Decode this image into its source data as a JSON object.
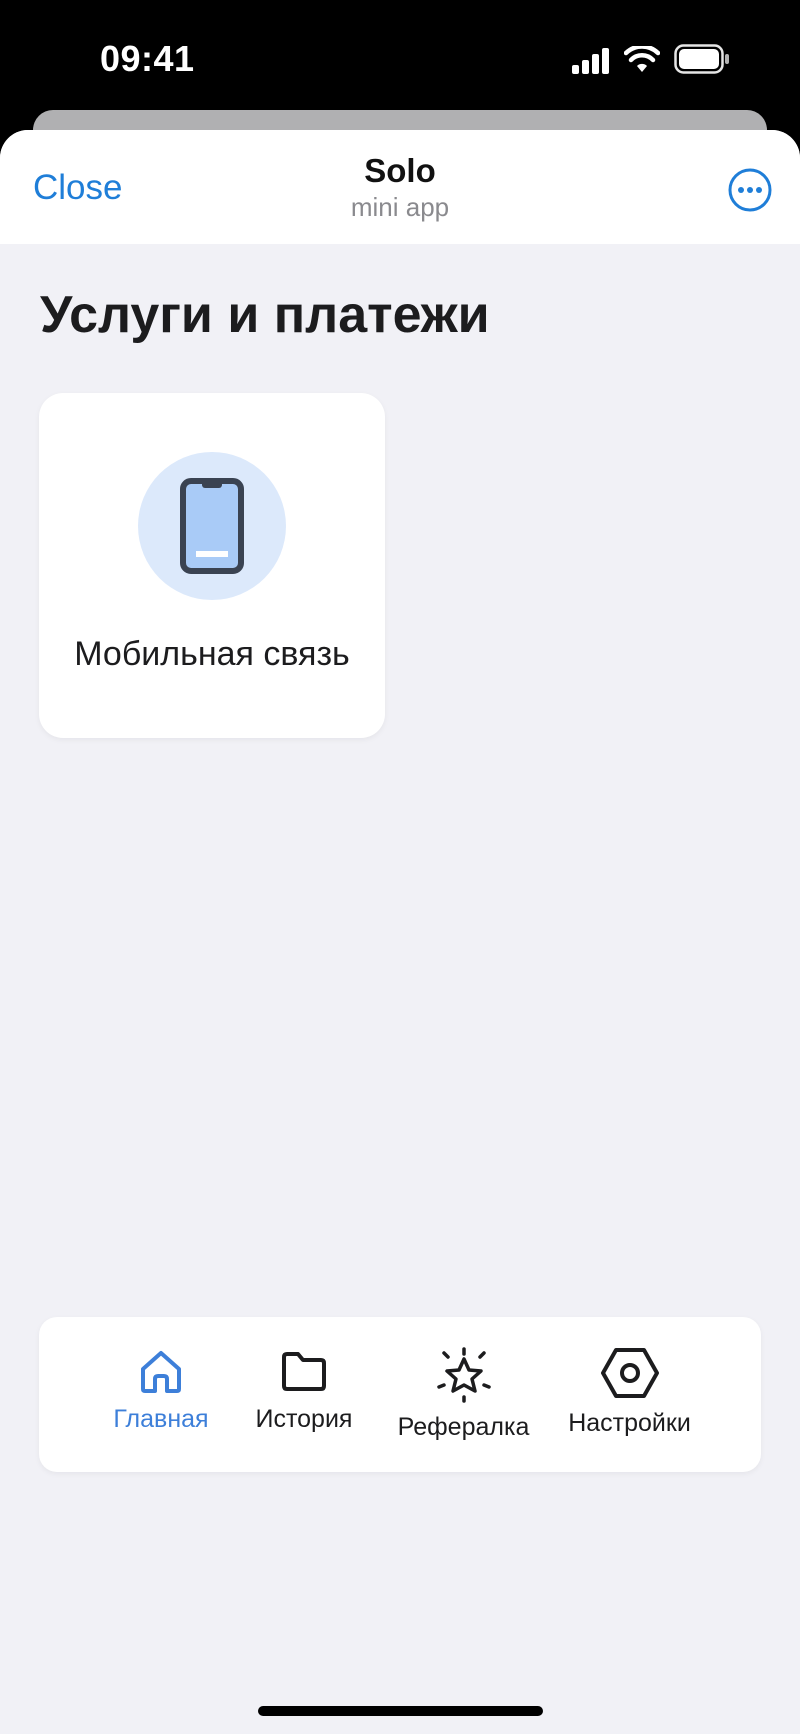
{
  "status": {
    "time": "09:41",
    "icons": [
      "cellular-signal-icon",
      "wifi-icon",
      "battery-icon"
    ]
  },
  "header": {
    "close_label": "Close",
    "title": "Solo",
    "subtitle": "mini app",
    "more_icon": "more-options-icon"
  },
  "main": {
    "title": "Услуги и платежи",
    "services": [
      {
        "label": "Мобильная связь",
        "icon": "mobile-phone-icon"
      }
    ]
  },
  "tab_bar": {
    "tabs": [
      {
        "label": "Главная",
        "icon": "home-icon",
        "active": true
      },
      {
        "label": "История",
        "icon": "folder-icon",
        "active": false
      },
      {
        "label": "Рефералка",
        "icon": "star-icon",
        "active": false
      },
      {
        "label": "Настройки",
        "icon": "settings-hexagon-icon",
        "active": false
      }
    ]
  },
  "colors": {
    "accent": "#1f7ed8",
    "tab_active": "#3d7fd9",
    "background": "#f1f1f6",
    "icon_circle": "#dce9fb",
    "phone_screen": "#a9cbf7",
    "phone_frame": "#3a4352"
  }
}
